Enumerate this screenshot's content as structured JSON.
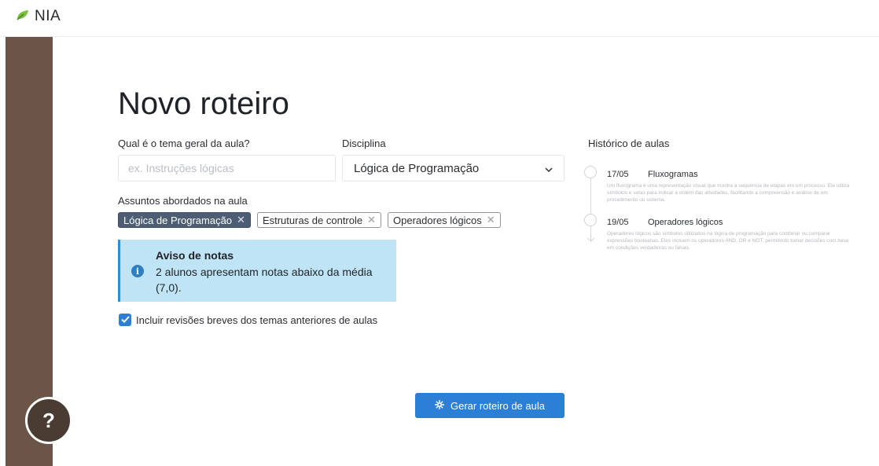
{
  "app": {
    "logo_text": "NIA"
  },
  "page": {
    "title": "Novo roteiro"
  },
  "form": {
    "theme_label": "Qual é o tema geral da aula?",
    "theme_placeholder": "ex. Instruções lógicas",
    "theme_value": "",
    "discipline_label": "Disciplina",
    "discipline_value": "Lógica de Programação",
    "subjects_label": "Assuntos abordados na aula",
    "subjects": [
      {
        "label": "Lógica de Programação",
        "active": true
      },
      {
        "label": "Estruturas de controle",
        "active": false
      },
      {
        "label": "Operadores lógicos",
        "active": false
      }
    ],
    "checkbox_label": "Incluir revisões breves dos temas anteriores de aulas",
    "checkbox_checked": true
  },
  "notice": {
    "title": "Aviso de notas",
    "text": "2 alunos apresentam notas abaixo da média (7,0)."
  },
  "history": {
    "title": "Histórico de aulas",
    "items": [
      {
        "date": "17/05",
        "name": "Fluxogramas",
        "desc": "Um fluxograma é uma representação visual que mostra a sequência de etapas em um processo. Ele utiliza símbolos e setas para indicar a ordem das atividades, facilitando a compreensão e análise de um procedimento ou sistema."
      },
      {
        "date": "19/05",
        "name": "Operadores lógicos",
        "desc": "Operadores lógicos são símbolos utilizados na lógica de programação para combinar ou comparar expressões booleanas. Eles incluem os operadores AND, OR e NOT, permitindo tomar decisões com base em condições verdadeiras ou falsas."
      }
    ]
  },
  "actions": {
    "generate_label": "Gerar roteiro de aula"
  },
  "help": {
    "label": "?"
  },
  "colors": {
    "sidebar": "#6b5548",
    "primary": "#2b7fd4",
    "notice_bg": "#bfe4f6",
    "active_tag": "#4d5d73"
  },
  "icons": {
    "logo": "leaf-icon",
    "select": "chevron-down-icon",
    "tag_remove": "close-icon",
    "notice": "info-icon",
    "checkbox": "check-icon",
    "generate": "sparkle-icon"
  }
}
